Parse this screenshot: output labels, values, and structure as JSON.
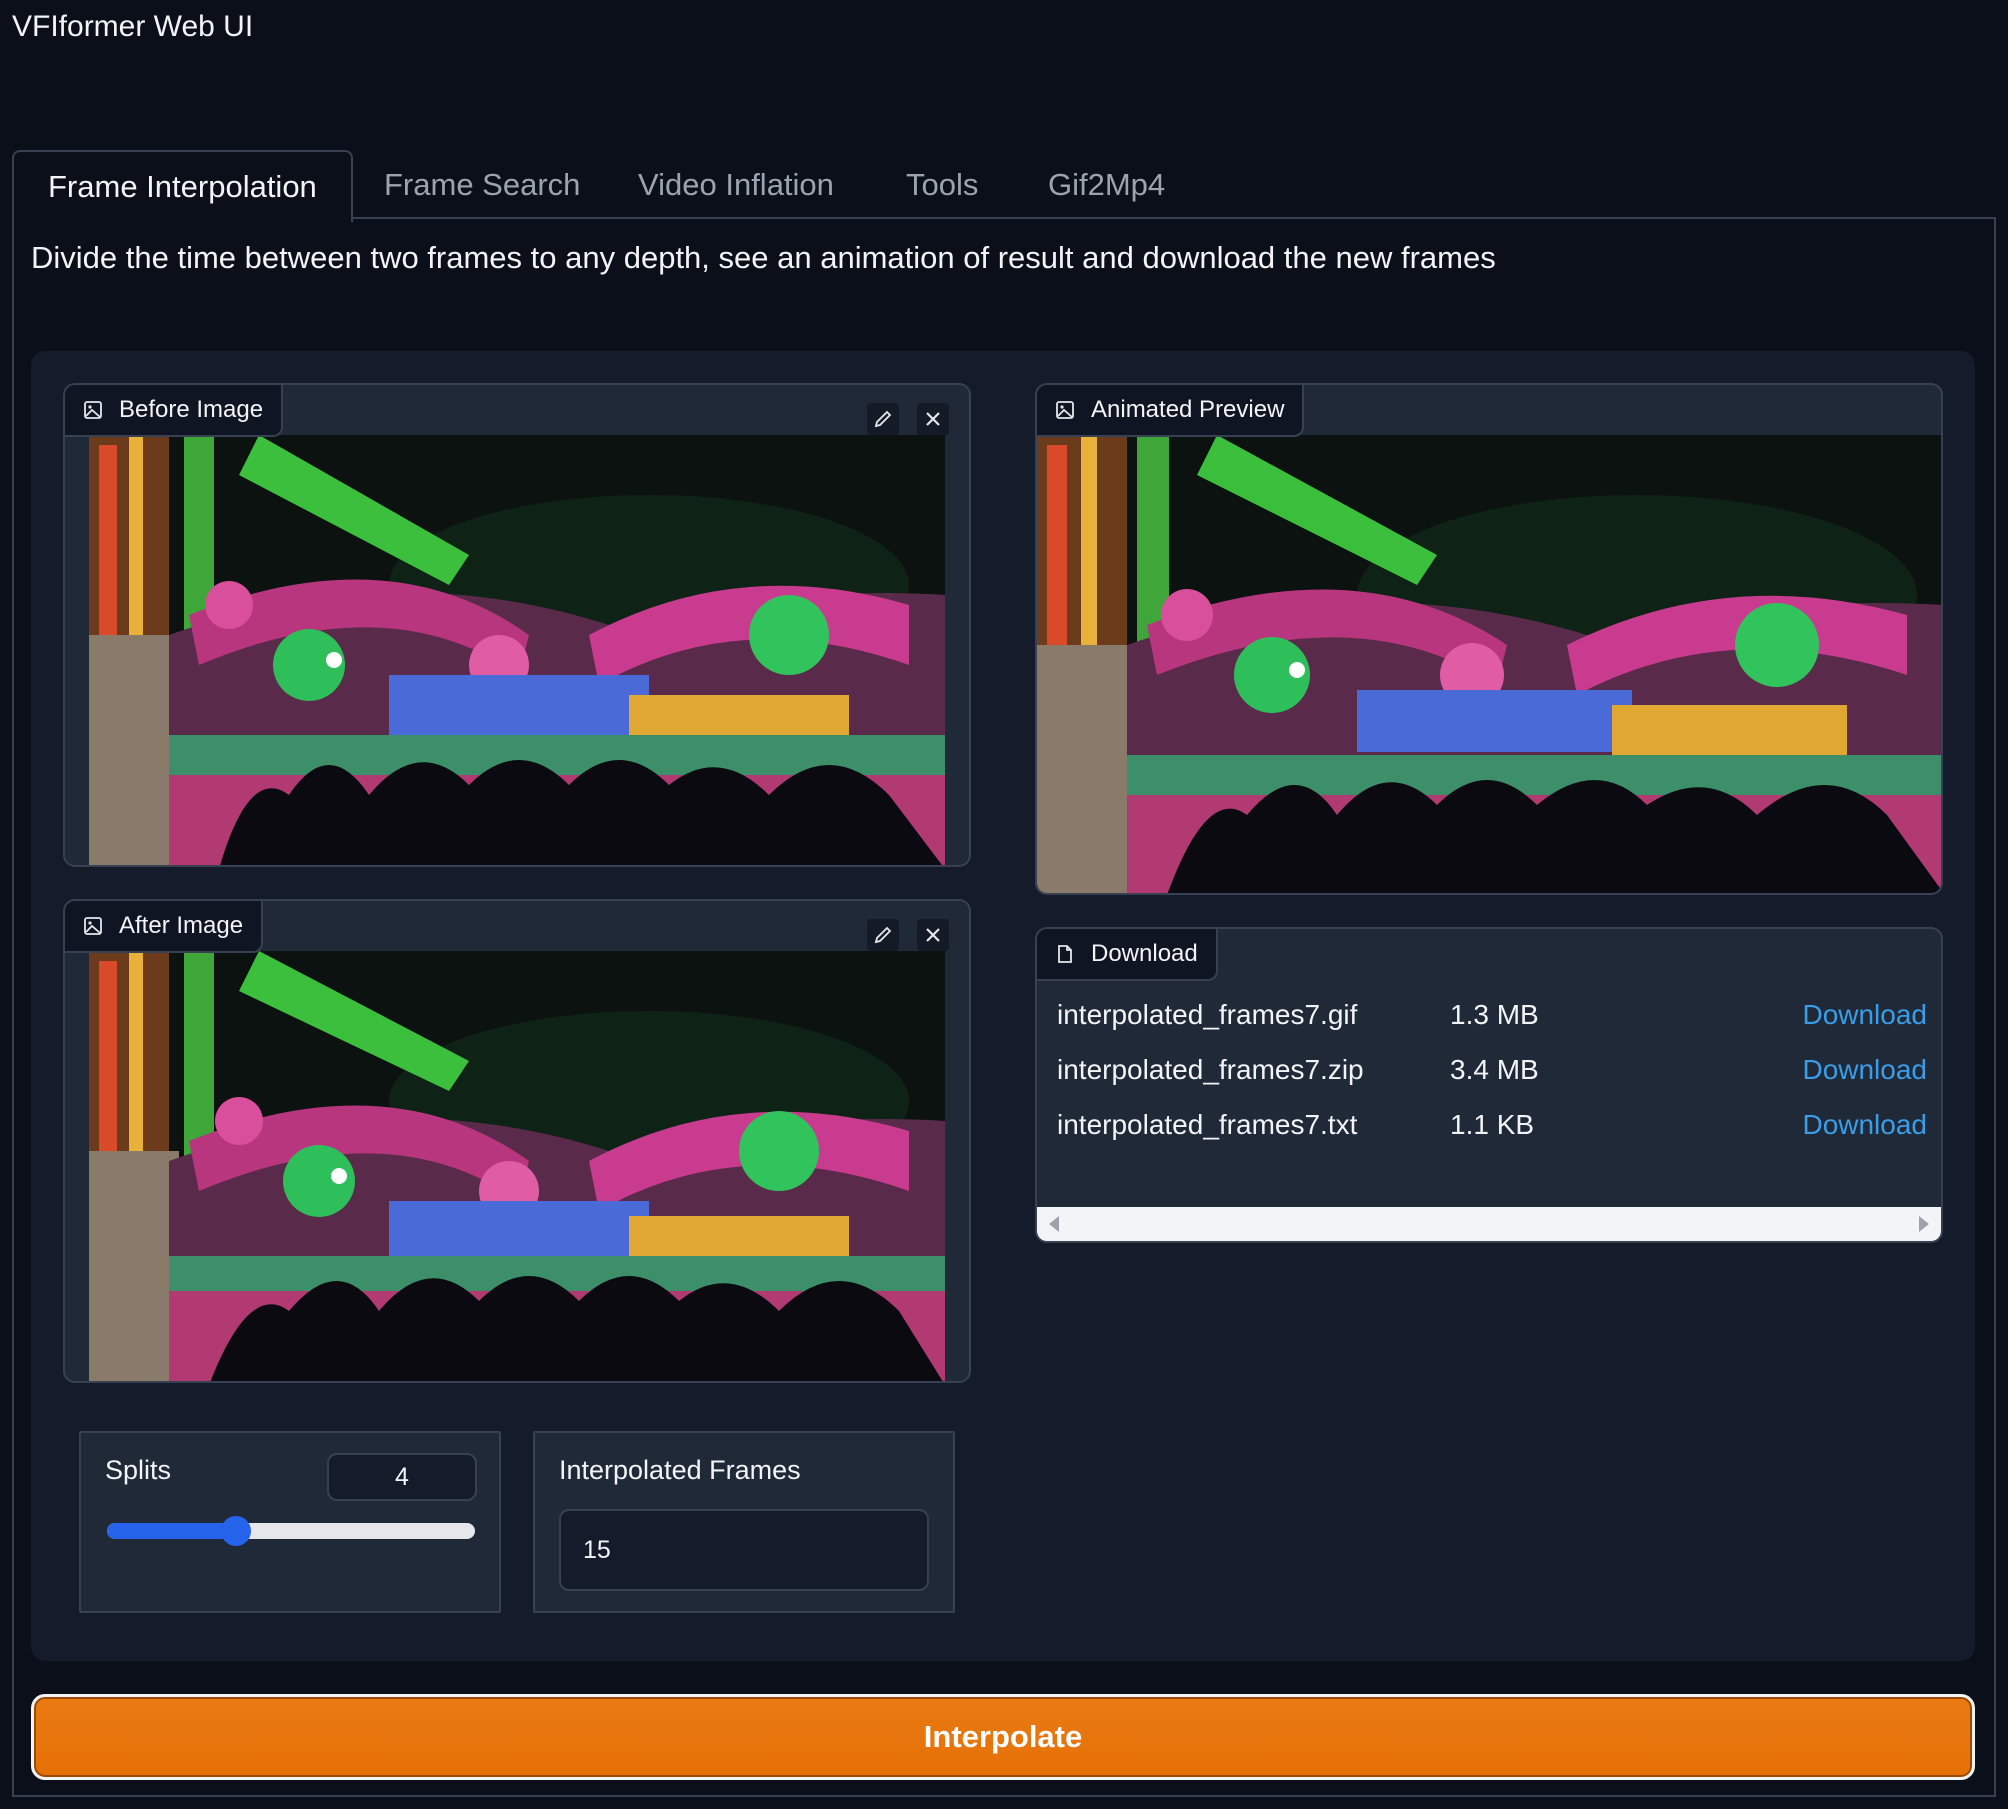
{
  "app": {
    "title": "VFIformer Web UI"
  },
  "tabs": [
    {
      "label": "Frame Interpolation",
      "active": true
    },
    {
      "label": "Frame Search"
    },
    {
      "label": "Video Inflation"
    },
    {
      "label": "Tools"
    },
    {
      "label": "Gif2Mp4"
    }
  ],
  "description": "Divide the time between two frames to any depth, see an animation of result and download the new frames",
  "before_image": {
    "label": "Before Image",
    "icon": "image-icon"
  },
  "after_image": {
    "label": "After Image",
    "icon": "image-icon"
  },
  "preview": {
    "label": "Animated Preview",
    "icon": "image-icon"
  },
  "download": {
    "label": "Download",
    "icon": "file-icon",
    "files": [
      {
        "name": "interpolated_frames7.gif",
        "size": "1.3 MB",
        "link": "Download"
      },
      {
        "name": "interpolated_frames7.zip",
        "size": "3.4 MB",
        "link": "Download"
      },
      {
        "name": "interpolated_frames7.txt",
        "size": "1.1 KB",
        "link": "Download"
      }
    ]
  },
  "splits": {
    "label": "Splits",
    "value": "4",
    "fraction": 0.35
  },
  "interpolated_frames": {
    "label": "Interpolated Frames",
    "value": "15"
  },
  "action": {
    "label": "Interpolate"
  },
  "colors": {
    "accent": "#e67008",
    "link": "#3b9de8",
    "slider": "#2563eb"
  }
}
